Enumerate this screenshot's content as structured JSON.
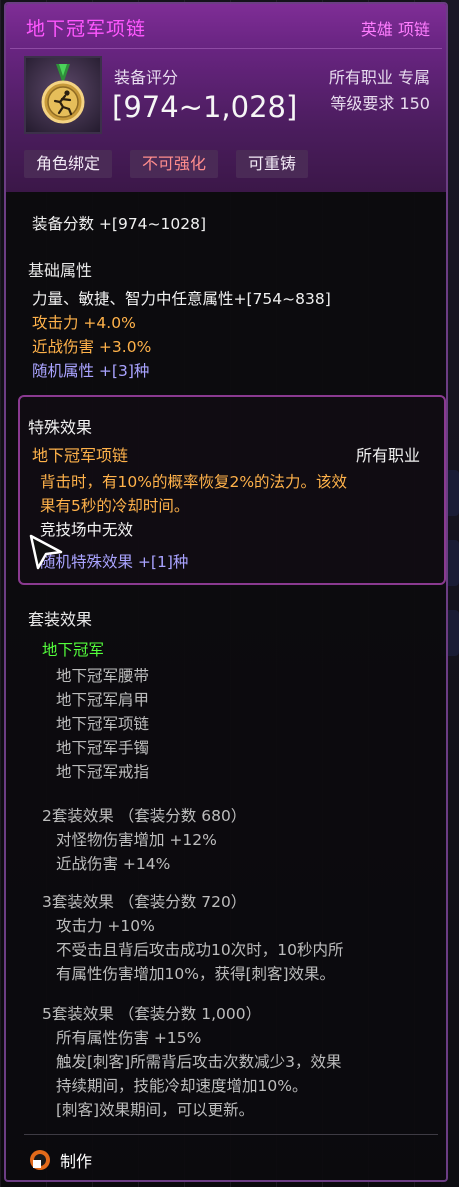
{
  "item": {
    "title": "地下冠军项链",
    "rarity": "英雄 项链",
    "icon": "gold-medal-runner-icon",
    "score_label": "装备评分",
    "score_value": "[974~1,028]",
    "job": "所有职业 专属",
    "level_req": "等级要求 150",
    "tags": [
      "角色绑定",
      "不可强化",
      "可重铸"
    ]
  },
  "stats": {
    "equip_score": "装备分数 +[974~1028]",
    "base_title": "基础属性",
    "base_lines": [
      {
        "text": "力量、敏捷、智力中任意属性+[754~838]"
      },
      {
        "text": "攻击力 +4.0%"
      },
      {
        "text": "近战伤害 +3.0%"
      },
      {
        "text": "随机属性 +[3]种"
      }
    ]
  },
  "special": {
    "title": "特殊效果",
    "name": "地下冠军项链",
    "job": "所有职业",
    "desc": [
      "背击时，有10%的概率恢复2%的法力。该效",
      "果有5秒的冷却时间。"
    ],
    "pvp": "竞技场中无效",
    "random": "随机特殊效果 +[1]种"
  },
  "set": {
    "title": "套装效果",
    "name": "地下冠军",
    "pieces": [
      "地下冠军腰带",
      "地下冠军肩甲",
      "地下冠军项链",
      "地下冠军手镯",
      "地下冠军戒指"
    ],
    "bonuses": [
      {
        "header": "2套装效果 （套装分数 680）",
        "lines": [
          "对怪物伤害增加 +12%",
          "近战伤害 +14%"
        ]
      },
      {
        "header": "3套装效果 （套装分数 720）",
        "lines": [
          "攻击力 +10%",
          "不受击且背后攻击成功10次时，10秒内所",
          "有属性伤害增加10%，获得[刺客]效果。"
        ]
      },
      {
        "header": "5套装效果 （套装分数 1,000）",
        "lines": [
          "所有属性伤害 +15%",
          "触发[刺客]所需背后攻击次数减少3，效果",
          "持续期间，技能冷却速度增加10%。",
          "[刺客]效果期间，可以更新。"
        ]
      }
    ]
  },
  "footer": {
    "craft": "制作"
  },
  "colors": {
    "title": "#ff57ff",
    "orange": "#ffb24a",
    "blue": "#a9a3ff",
    "green": "#54ff3c",
    "border": "#6c3d84"
  }
}
